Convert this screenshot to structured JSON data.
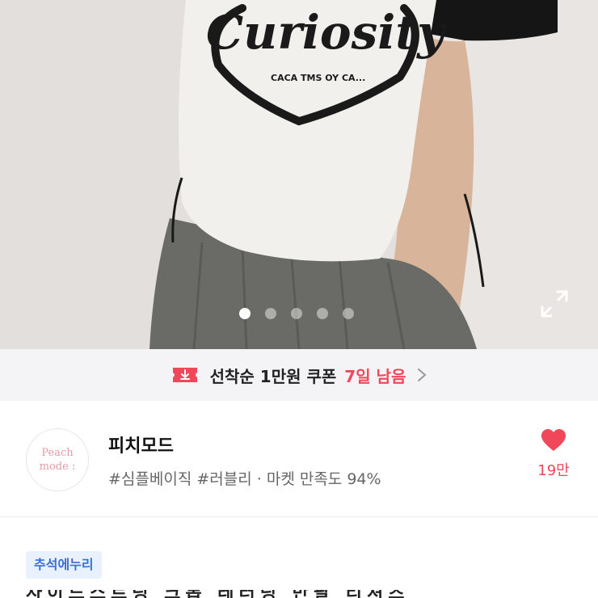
{
  "product_image": {
    "shirt_print": {
      "script_word": "Curiosity",
      "small_text": "CACA TMS OY CA..."
    },
    "carousel": {
      "count": 5,
      "active_index": 0
    }
  },
  "coupon": {
    "text": "선착순 1만원 쿠폰",
    "days_left": "7일 남음",
    "accent_color": "#f0475b"
  },
  "shop": {
    "logo_line1": "Peach",
    "logo_line2": "mode :",
    "name": "피치모드",
    "meta": "#심플베이직 #러블리 · 마켓 만족도 94%",
    "likes": "19만"
  },
  "tag": {
    "label": "추석에누리"
  },
  "title_preview": "사이드스트링 크롭 레터링 반팔 티셔츠"
}
